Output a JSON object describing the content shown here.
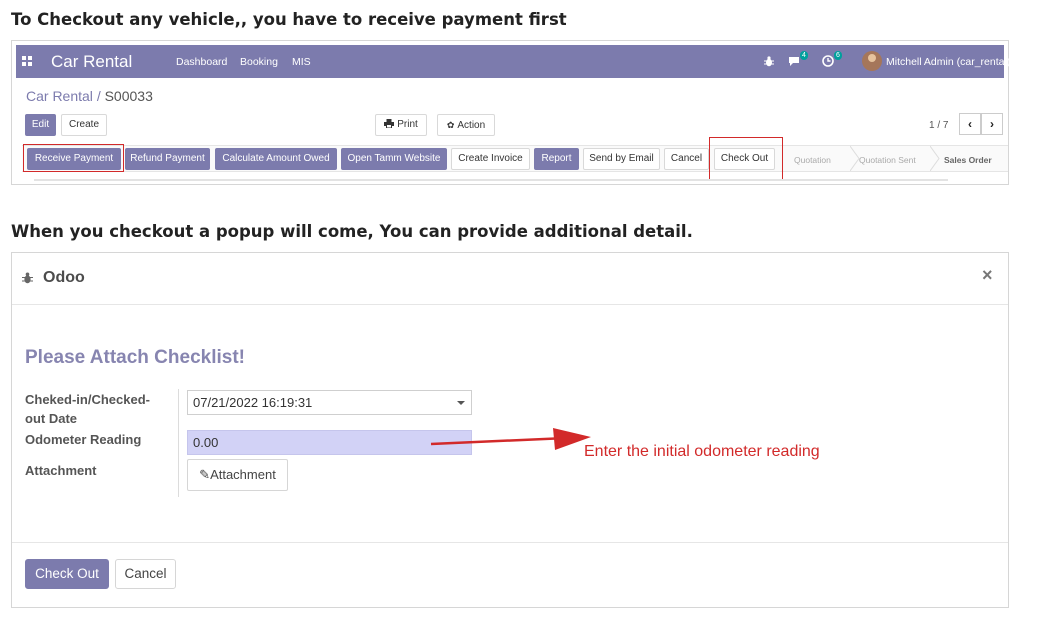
{
  "headings": {
    "checkout_info": "To Checkout any vehicle,, you have to receive payment first",
    "popup_info": "When you checkout a popup will come, You can provide additional detail."
  },
  "navbar": {
    "brand": "Car Rental",
    "menu": [
      "Dashboard",
      "Booking",
      "MIS"
    ],
    "messages_count": "4",
    "activities_count": "6",
    "user": "Mitchell Admin (car_rental)",
    "color": "#7c7bad"
  },
  "breadcrumb": {
    "parent": "Car Rental",
    "separator": "/",
    "current": "S00033"
  },
  "control_panel": {
    "edit_label": "Edit",
    "create_label": "Create",
    "print_label": "Print",
    "action_label": "Action",
    "pager": "1 / 7"
  },
  "action_buttons": {
    "receive_payment": "Receive Payment",
    "refund_payment": "Refund Payment",
    "calculate_amount": "Calculate Amount Owed",
    "open_tamm": "Open Tamm Website",
    "create_invoice": "Create Invoice",
    "report": "Report",
    "send_email": "Send by Email",
    "cancel": "Cancel",
    "check_out": "Check Out"
  },
  "status_stages": [
    "Quotation",
    "Quotation Sent",
    "Sales Order"
  ],
  "status_active": "Sales Order",
  "dialog": {
    "title": "Odoo",
    "form_title": "Please Attach Checklist!",
    "date_label_line1": "Cheked-in/Checked-",
    "date_label_line2": "out Date",
    "date_value": "07/21/2022 16:19:31",
    "odometer_label": "Odometer Reading",
    "odometer_value": "0.00",
    "attachment_label": "Attachment",
    "attachment_button": "Attachment",
    "check_out_button": "Check Out",
    "cancel_button": "Cancel"
  },
  "annotation": {
    "text": "Enter the initial odometer reading",
    "color": "#d22a2a"
  },
  "icons": [
    "apps-icon",
    "bug-icon",
    "chat-icon",
    "clock-icon",
    "print-icon",
    "gear-icon",
    "chevron-left-icon",
    "chevron-right-icon",
    "paperclip-icon",
    "close-icon",
    "caret-down-icon"
  ]
}
